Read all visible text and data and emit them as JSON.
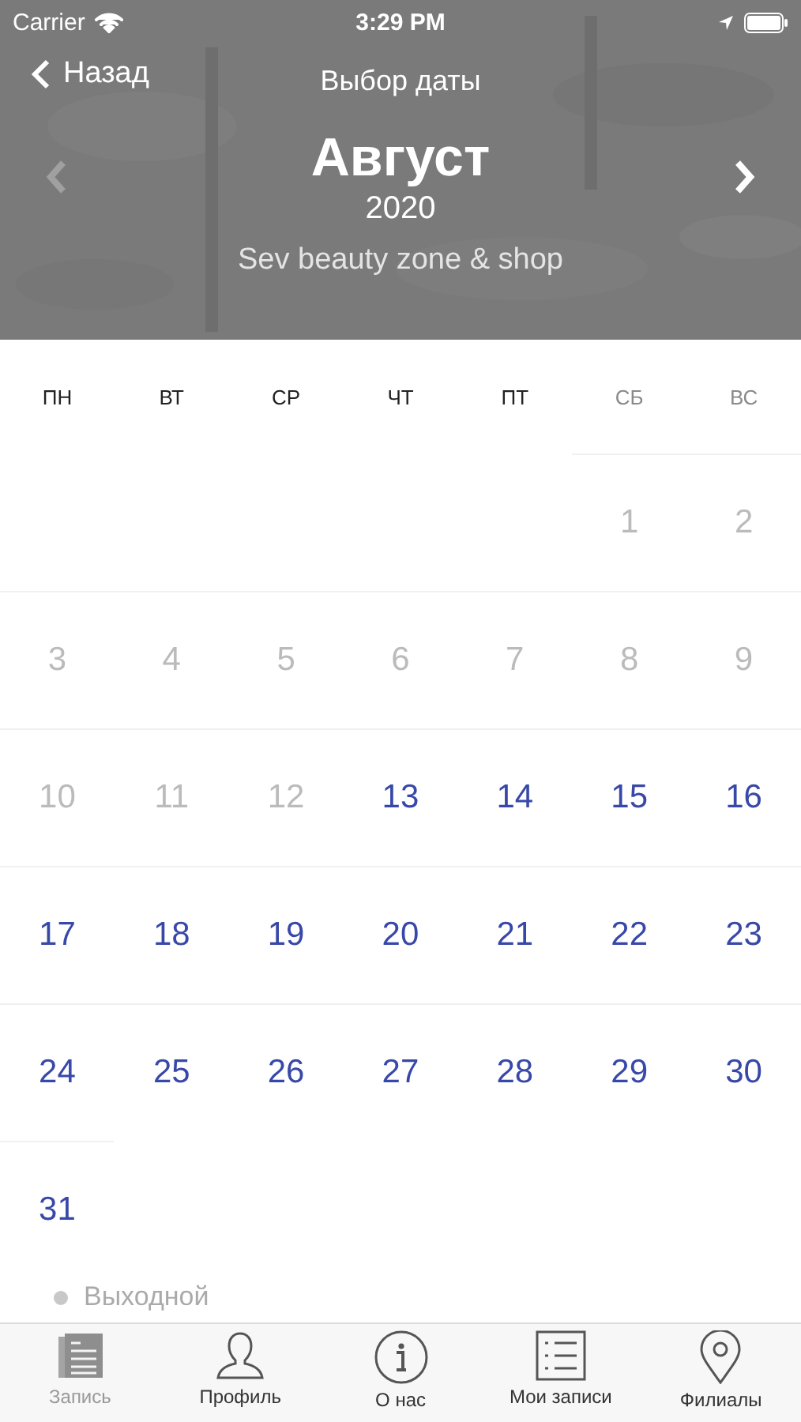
{
  "status_bar": {
    "carrier": "Carrier",
    "time": "3:29 PM"
  },
  "nav": {
    "back": "Назад",
    "title": "Выбор даты"
  },
  "month": {
    "name": "Август",
    "year": "2020",
    "prev_disabled": true,
    "next_disabled": false,
    "subtitle": "Sev beauty zone & shop"
  },
  "weekdays": [
    {
      "label": "ПН",
      "weekend": false
    },
    {
      "label": "ВТ",
      "weekend": false
    },
    {
      "label": "СР",
      "weekend": false
    },
    {
      "label": "ЧТ",
      "weekend": false
    },
    {
      "label": "ПТ",
      "weekend": false
    },
    {
      "label": "СБ",
      "weekend": true
    },
    {
      "label": "ВС",
      "weekend": true
    }
  ],
  "weeks": [
    {
      "days": [
        {
          "day": "1",
          "disabled": true
        },
        {
          "day": "2",
          "disabled": true
        }
      ]
    },
    {
      "days": [
        {
          "day": "3",
          "disabled": true
        },
        {
          "day": "4",
          "disabled": true
        },
        {
          "day": "5",
          "disabled": true
        },
        {
          "day": "6",
          "disabled": true
        },
        {
          "day": "7",
          "disabled": true
        },
        {
          "day": "8",
          "disabled": true
        },
        {
          "day": "9",
          "disabled": true
        }
      ]
    },
    {
      "days": [
        {
          "day": "10",
          "disabled": true
        },
        {
          "day": "11",
          "disabled": true
        },
        {
          "day": "12",
          "disabled": true
        },
        {
          "day": "13",
          "disabled": false
        },
        {
          "day": "14",
          "disabled": false
        },
        {
          "day": "15",
          "disabled": false
        },
        {
          "day": "16",
          "disabled": false
        }
      ]
    },
    {
      "days": [
        {
          "day": "17",
          "disabled": false
        },
        {
          "day": "18",
          "disabled": false
        },
        {
          "day": "19",
          "disabled": false
        },
        {
          "day": "20",
          "disabled": false
        },
        {
          "day": "21",
          "disabled": false
        },
        {
          "day": "22",
          "disabled": false
        },
        {
          "day": "23",
          "disabled": false
        }
      ]
    },
    {
      "days": [
        {
          "day": "24",
          "disabled": false
        },
        {
          "day": "25",
          "disabled": false
        },
        {
          "day": "26",
          "disabled": false
        },
        {
          "day": "27",
          "disabled": false
        },
        {
          "day": "28",
          "disabled": false
        },
        {
          "day": "29",
          "disabled": false
        },
        {
          "day": "30",
          "disabled": false
        }
      ]
    },
    {
      "days": [
        {
          "day": "31",
          "disabled": false
        }
      ]
    }
  ],
  "legend": [
    {
      "label": "Выходной",
      "color": "#c8c8c8"
    }
  ],
  "tab_bar": [
    {
      "label": "Запись",
      "selected": true
    },
    {
      "label": "Профиль",
      "selected": false
    },
    {
      "label": "О нас",
      "selected": false
    },
    {
      "label": "Мои записи",
      "selected": false
    },
    {
      "label": "Филиалы",
      "selected": false
    }
  ]
}
